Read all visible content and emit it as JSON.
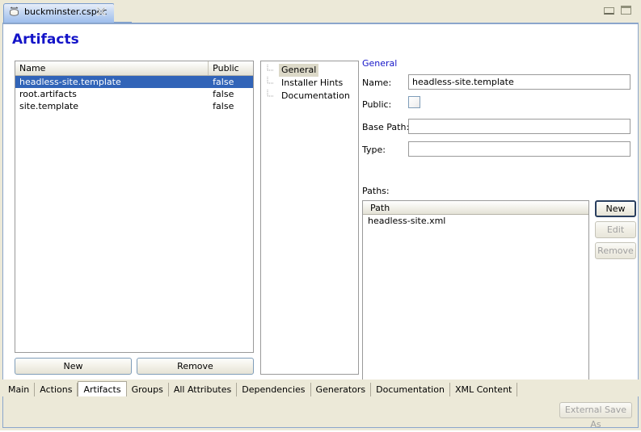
{
  "window": {
    "minimize_icon": "minimize-icon",
    "maximize_icon": "maximize-icon"
  },
  "editor_tab": {
    "label": "buckminster.cspec",
    "icon": "cspec-file-icon",
    "close_icon": "close-icon"
  },
  "page": {
    "title": "Artifacts"
  },
  "artifacts_table": {
    "columns": [
      "Name",
      "Public"
    ],
    "rows": [
      {
        "name": "headless-site.template",
        "public": "false",
        "selected": true
      },
      {
        "name": "root.artifacts",
        "public": "false",
        "selected": false
      },
      {
        "name": "site.template",
        "public": "false",
        "selected": false
      }
    ]
  },
  "list_buttons": {
    "new_label": "New",
    "remove_label": "Remove"
  },
  "tree": {
    "items": [
      {
        "label": "General",
        "selected": true
      },
      {
        "label": "Installer Hints",
        "selected": false
      },
      {
        "label": "Documentation",
        "selected": false
      }
    ]
  },
  "form": {
    "group_title": "General",
    "name_label": "Name:",
    "name_value": "headless-site.template",
    "public_label": "Public:",
    "public_checked": false,
    "base_path_label": "Base Path:",
    "base_path_value": "",
    "type_label": "Type:",
    "type_value": ""
  },
  "paths": {
    "section_label": "Paths:",
    "column": "Path",
    "rows": [
      "headless-site.xml"
    ],
    "buttons": {
      "new_label": "New",
      "edit_label": "Edit",
      "remove_label": "Remove"
    }
  },
  "bottom_tabs": {
    "items": [
      {
        "label": "Main",
        "active": false
      },
      {
        "label": "Actions",
        "active": false
      },
      {
        "label": "Artifacts",
        "active": true
      },
      {
        "label": "Groups",
        "active": false
      },
      {
        "label": "All Attributes",
        "active": false
      },
      {
        "label": "Dependencies",
        "active": false
      },
      {
        "label": "Generators",
        "active": false
      },
      {
        "label": "Documentation",
        "active": false
      },
      {
        "label": "XML Content",
        "active": false
      }
    ]
  },
  "status_bar": {
    "external_save_label": "External Save As"
  },
  "colors": {
    "title_blue": "#1414c8",
    "selection_blue": "#3164b8",
    "chrome_beige": "#ece9d8",
    "frame_blue": "#8ba6cc"
  }
}
